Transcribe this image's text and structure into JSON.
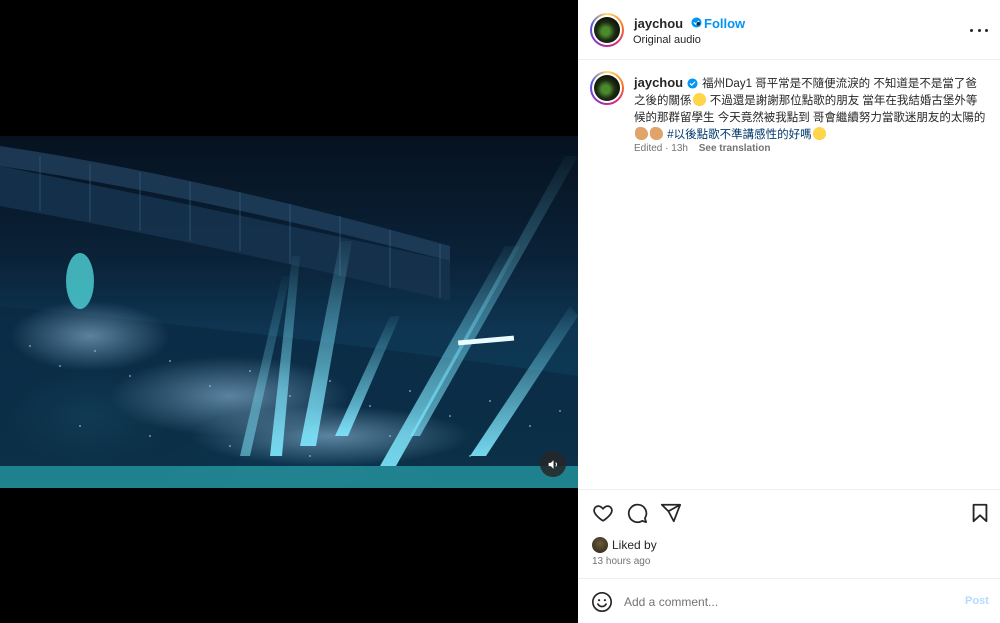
{
  "post": {
    "author": "jaychou",
    "follow_label": "Follow",
    "separator": "•",
    "audio_label": "Original audio",
    "caption_part1": "福州Day1 哥平常是不隨便流淚的 不知道是不是當了爸之後的關係",
    "caption_part2": "不過還是謝謝那位點歌的朋友 當年在我結婚古堡外等候的那群留學生 今天竟然被我點到 哥會繼續努力當歌迷朋友的太陽的",
    "hashtags": "#以後點歌不準講感性的好嗎",
    "edited_label": "Edited",
    "edited_separator": "·",
    "edited_time": "13h",
    "see_translation": "See translation",
    "liked_by_label": "Liked by",
    "posted_ago": "13 hours ago",
    "comment_placeholder": "Add a comment...",
    "post_button": "Post"
  },
  "icons": {
    "verified": "verified-badge-icon",
    "more": "more-options-icon",
    "like": "heart-icon",
    "comment": "comment-icon",
    "share": "share-icon",
    "save": "bookmark-icon",
    "mute": "speaker-icon",
    "emoji": "smiley-icon"
  },
  "colors": {
    "accent": "#0095f6",
    "hashtag": "#00376b",
    "muted": "#737373",
    "post_disabled": "#b3dbff"
  }
}
